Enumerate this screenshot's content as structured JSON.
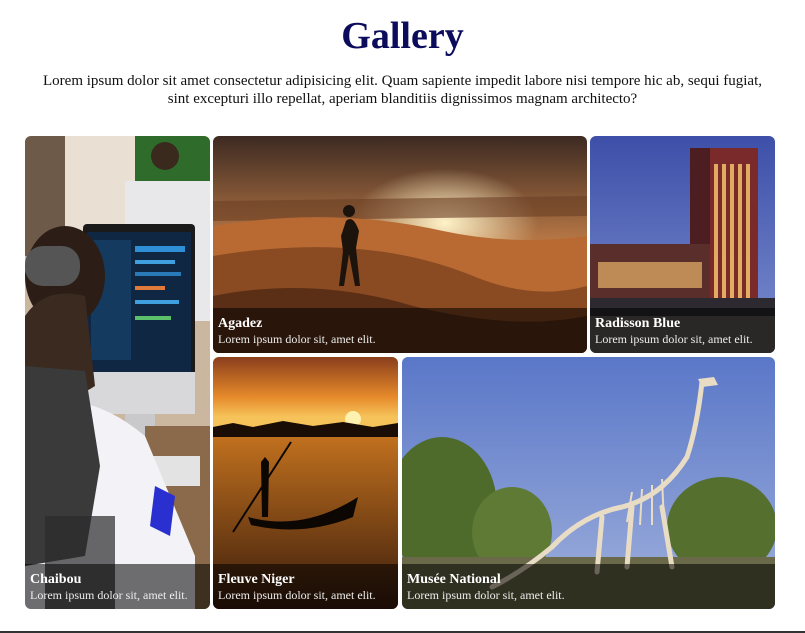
{
  "page": {
    "title": "Gallery",
    "intro": "Lorem ipsum dolor sit amet consectetur adipisicing elit. Quam sapiente impedit labore nisi tempore hic ab, sequi fugiat, sint excepturi illo repellat, aperiam blanditiis dignissimos magnam architecto?"
  },
  "gallery": [
    {
      "name": "Chaibou",
      "desc": "Lorem ipsum dolor sit, amet elit."
    },
    {
      "name": "Agadez",
      "desc": "Lorem ipsum dolor sit, amet elit."
    },
    {
      "name": "Radisson Blue",
      "desc": "Lorem ipsum dolor sit, amet elit."
    },
    {
      "name": "Fleuve Niger",
      "desc": "Lorem ipsum dolor sit, amet elit."
    },
    {
      "name": "Musée National",
      "desc": "Lorem ipsum dolor sit, amet elit."
    }
  ],
  "colors": {
    "title": "#0c0c5c",
    "caption_bg": "rgba(0,0,0,0.55)"
  }
}
